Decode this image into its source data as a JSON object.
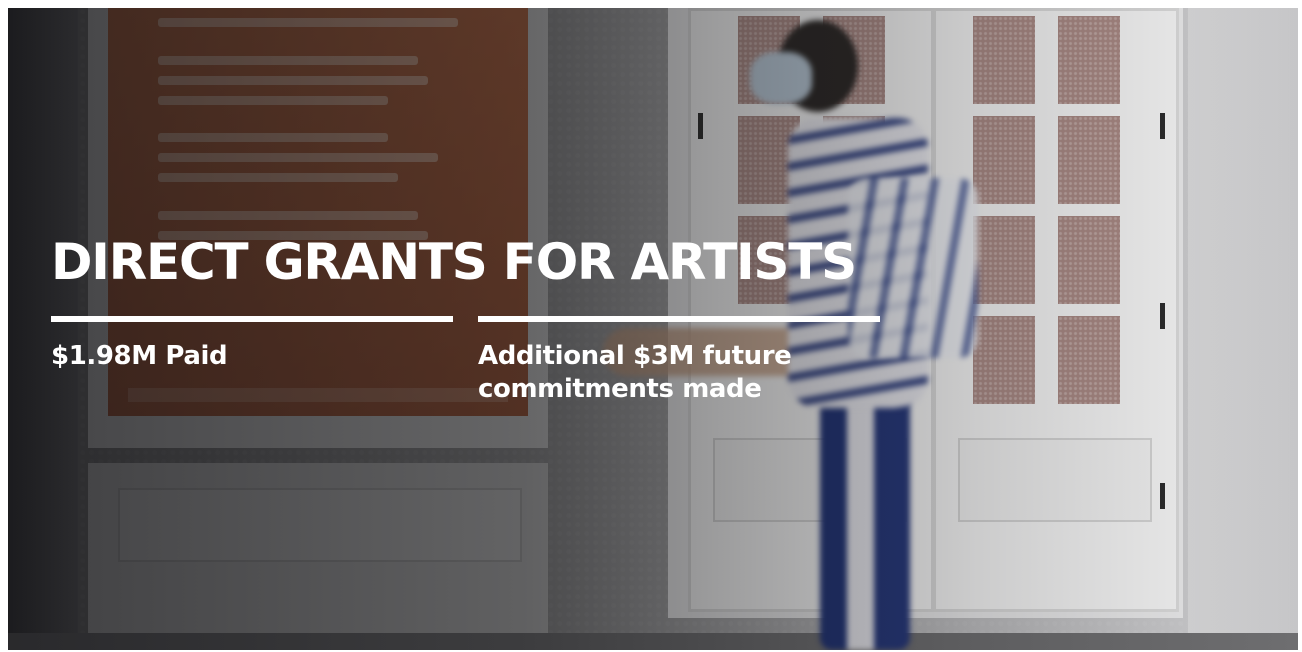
{
  "hero": {
    "headline": "DIRECT GRANTS FOR ARTISTS",
    "stats": [
      {
        "label": "$1.98M Paid"
      },
      {
        "label_line1": "Additional $3M future",
        "label_line2": "commitments made"
      }
    ]
  },
  "colors": {
    "text": "#ffffff",
    "overlay": "#141416",
    "poster": "#b5643e"
  }
}
